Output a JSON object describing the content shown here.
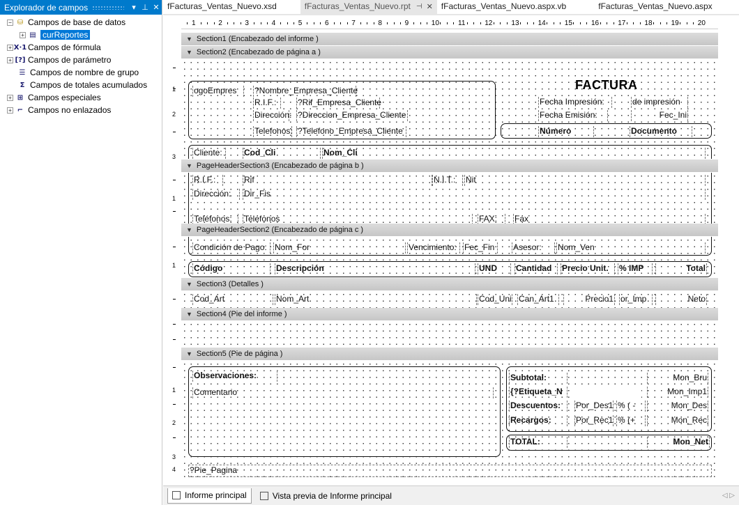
{
  "explorer": {
    "title": "Explorador de campos",
    "pin_icon": "pin-icon",
    "close_icon": "close-icon",
    "items": [
      {
        "label": "Campos de base de datos",
        "expander": "-",
        "icon": "db"
      },
      {
        "label": "curReportes",
        "expander": "+",
        "icon": "table"
      },
      {
        "label": "Campos de fórmula",
        "expander": "+",
        "icon": "X·1"
      },
      {
        "label": "Campos de parámetro",
        "expander": "+",
        "icon": "[?]"
      },
      {
        "label": "Campos de nombre de grupo",
        "expander": "",
        "icon": "grp"
      },
      {
        "label": "Campos de totales acumulados",
        "expander": "",
        "icon": "sum"
      },
      {
        "label": "Campos especiales",
        "expander": "+",
        "icon": "spc"
      },
      {
        "label": "Campos no enlazados",
        "expander": "+",
        "icon": "unb"
      }
    ]
  },
  "tabs": [
    {
      "label": "fFacturas_Ventas_Nuevo.xsd"
    },
    {
      "label": "fFacturas_Ventas_Nuevo.rpt",
      "active": true
    },
    {
      "label": "fFacturas_Ventas_Nuevo.aspx.vb"
    },
    {
      "label": "fFacturas_Ventas_Nuevo.aspx"
    }
  ],
  "ruler": {
    "numbers": [
      "1",
      "2",
      "3",
      "4",
      "5",
      "6",
      "7",
      "8",
      "9",
      "10",
      "11",
      "12",
      "13",
      "14",
      "15",
      "16",
      "17",
      "18",
      "19",
      "20"
    ]
  },
  "sections": {
    "s1": "Section1 (Encabezado del informe  )",
    "s2": "Section2 (Encabezado de página a )",
    "s3": "PageHeaderSection3 (Encabezado de página b )",
    "s4": "PageHeaderSection2 (Encabezado de página c )",
    "s5": "Section3 (Detalles  )",
    "s6": "Section4 (Pie del informe  )",
    "s7": "Section5 (Pie de página  )"
  },
  "header_a": {
    "logo": "ogoEmpres",
    "nombre": "?Nombre_Empresa_Cliente",
    "rif_label": "R.I.F.:",
    "rif_value": "?Rif_Empresa_Cliente",
    "dir_label": "Dirección:",
    "dir_value": "?Direccion_Empresa_Cliente",
    "tel_label": "Telefonos:",
    "tel_value": "?Telefono_Empresa_Cliente",
    "factura": "FACTURA",
    "fecha_imp_label": "Fecha Impresión:",
    "fecha_imp_value": "de impresión",
    "fecha_emi_label": "Fecha Emisión:",
    "fecha_emi_value": "Fec_Ini",
    "numero": "Número",
    "documento": "Documento",
    "cliente_label": "Cliente:",
    "cod_cli": "Cod_Cli",
    "nom_cli": "Nom_Cli"
  },
  "header_b": {
    "rif_label": "R.I.F.:",
    "rif_value": "Rif",
    "nit_label": "N.I.T.:",
    "nit_value": "Nit",
    "dir_label": "Dirección:",
    "dir_value": "Dir_Fis",
    "tel_label": "Teléfonos:",
    "tel_value": "Telefonos",
    "fax_label": "FAX:",
    "fax_value": "Fax"
  },
  "header_c": {
    "cond_label": "Condición de Pago:",
    "cond_value": "Nom_For",
    "venc_label": "Vencimiento:",
    "venc_value": "Fec_Fin",
    "asesor_label": "Asesor:",
    "asesor_value": "Nom_Ven",
    "col_codigo": "Código",
    "col_desc": "Descripción",
    "col_und": "UND",
    "col_cant": "Cantidad",
    "col_precio": "Precio Unit.",
    "col_imp": "% IMP",
    "col_total": "Total"
  },
  "detalles": {
    "cod_art": "Cod_Art",
    "nom_art": "Nom_Art",
    "cod_uni": "Cod_Uni",
    "can_art": "Can_Art1",
    "precio": "Precio1",
    "por_imp": "or_Imp",
    "neto": "Neto"
  },
  "footer": {
    "obs_label": "Observaciones:",
    "comentario": "Comentario",
    "subtotal_label": "Subtotal:",
    "subtotal_value": "Mon_Bru",
    "etiqueta": "{?Etiqueta_N",
    "mon_imp": "Mon_Imp1",
    "desc_label": "Descuentos:",
    "por_des": "Por_Des1",
    "desc_pct": "% ( -",
    "mon_des": "Mon_Des",
    "rec_label": "Recargos:",
    "por_rec": "Por_Rec1",
    "rec_pct": "% (+",
    "mon_rec": "Mon_Rec",
    "total_label": "TOTAL:",
    "mon_net": "Mon_Net",
    "pie_pagina": "?Pie_Pagina"
  },
  "bottom_tabs": [
    {
      "label": "Informe principal",
      "active": true
    },
    {
      "label": "Vista previa de Informe principal"
    }
  ]
}
